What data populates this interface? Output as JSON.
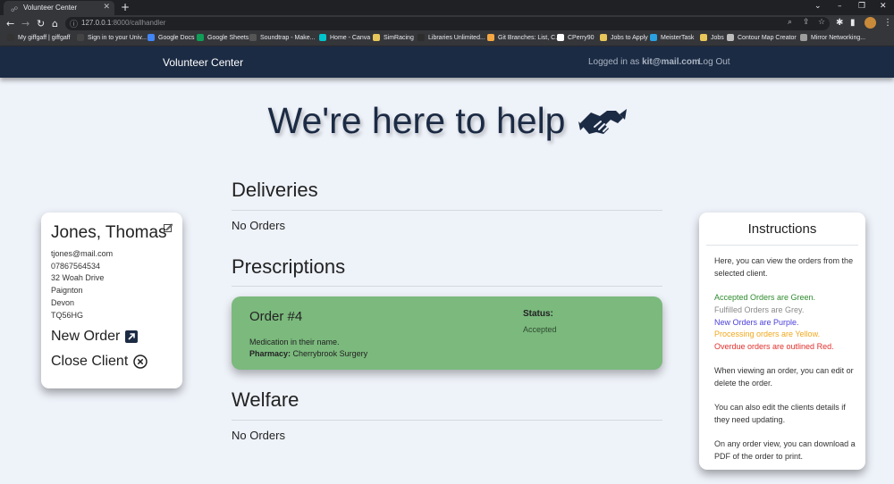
{
  "browser": {
    "tab_title": "Volunteer Center",
    "url_host": "127.0.0.1",
    "url_path": ":8000/callhandler",
    "bookmarks": [
      {
        "label": "My giffgaff | giffgaff",
        "color": "#333333",
        "icon": "giffgaff-icon"
      },
      {
        "label": "Sign in to your Univ...",
        "color": "#444444",
        "icon": "university-icon"
      },
      {
        "label": "Google Docs",
        "color": "#4285f4",
        "icon": "docs-icon"
      },
      {
        "label": "Google Sheets",
        "color": "#0f9d58",
        "icon": "sheets-icon"
      },
      {
        "label": "Soundtrap - Make...",
        "color": "#555555",
        "icon": "soundtrap-icon"
      },
      {
        "label": "Home - Canva",
        "color": "#00c4cc",
        "icon": "canva-icon"
      },
      {
        "label": "SimRacing",
        "color": "#e8c65a",
        "icon": "folder-icon"
      },
      {
        "label": "Libraries Unlimited...",
        "color": "#2d2d2d",
        "icon": "library-icon"
      },
      {
        "label": "Git Branches: List, C...",
        "color": "#f4a742",
        "icon": "git-icon"
      },
      {
        "label": "CPerry90",
        "color": "#ffffff",
        "icon": "github-icon"
      },
      {
        "label": "Jobs to Apply",
        "color": "#e8c65a",
        "icon": "folder-icon"
      },
      {
        "label": "MeisterTask",
        "color": "#2aa1e0",
        "icon": "meistertask-icon"
      },
      {
        "label": "Jobs",
        "color": "#e8c65a",
        "icon": "folder-icon"
      },
      {
        "label": "Contour Map Creator",
        "color": "#bdbdbd",
        "icon": "globe-icon"
      },
      {
        "label": "Mirror Networking...",
        "color": "#9e9e9e",
        "icon": "mirror-icon"
      }
    ]
  },
  "nav": {
    "brand": "Volunteer Center",
    "logged_in_prefix": "Logged in as",
    "user_email": "kit@mail.com",
    "logout": "Log Out"
  },
  "hero": {
    "title": "We're here to help"
  },
  "client": {
    "name": "Jones, Thomas",
    "email": "tjones@mail.com",
    "phone": "07867564534",
    "address_line1": "32 Woah Drive",
    "town": "Paignton",
    "county": "Devon",
    "postcode": "TQ56HG",
    "new_order": "New Order",
    "close_client": "Close Client"
  },
  "sections": {
    "deliveries": {
      "title": "Deliveries",
      "empty": "No Orders"
    },
    "prescriptions": {
      "title": "Prescriptions"
    },
    "welfare": {
      "title": "Welfare",
      "empty": "No Orders"
    }
  },
  "order": {
    "title": "Order #4",
    "description": "Medication in their name.",
    "pharmacy_label": "Pharmacy:",
    "pharmacy": "Cherrybrook Surgery",
    "status_label": "Status:",
    "status": "Accepted",
    "color": "#7bb97d"
  },
  "instructions": {
    "title": "Instructions",
    "intro": "Here, you can view the orders from the selected client.",
    "legend": [
      {
        "text": "Accepted Orders are Green.",
        "color": "#2e8b2e"
      },
      {
        "text": "Fulfilled Orders are Grey.",
        "color": "#8a8a8a"
      },
      {
        "text": "New Orders are Purple.",
        "color": "#4b3fd9"
      },
      {
        "text": "Processing orders are Yellow.",
        "color": "#f0a81c"
      },
      {
        "text": "Overdue orders are outlined Red.",
        "color": "#e0302c"
      }
    ],
    "edit_note": "When viewing an order, you can edit or delete the order.",
    "client_note": "You can also edit the clients details if they need updating.",
    "pdf_note": "On any order view, you can download a PDF of the order to print."
  }
}
